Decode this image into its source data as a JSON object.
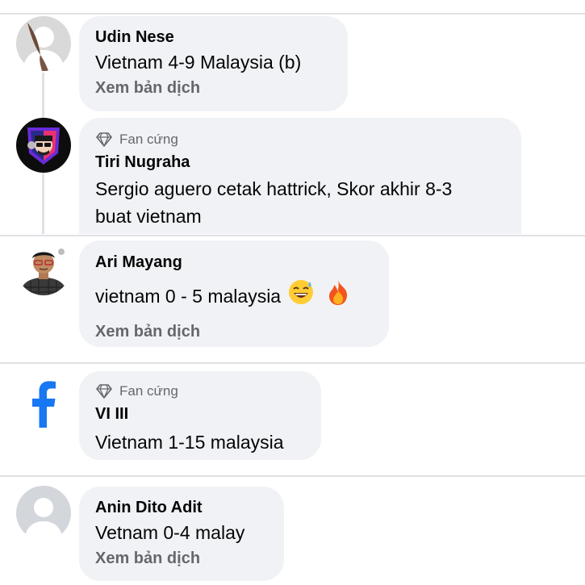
{
  "comments": [
    {
      "name": "Udin Nese",
      "text": "Vietnam 4-9 Malaysia (b)",
      "translate": "Xem bản dịch"
    },
    {
      "badge": "Fan cứng",
      "name": "Tiri Nugraha",
      "text_lines": [
        "Sergio aguero cetak hattrick, Skor akhir 8-3",
        "buat vietnam"
      ]
    },
    {
      "name": "Ari Mayang",
      "text": "vietnam 0 - 5 malaysia",
      "emojis": [
        "😅",
        "🔥"
      ],
      "translate": "Xem bản dịch"
    },
    {
      "badge": "Fan cứng",
      "name": "VI III",
      "text": "Vietnam 1-15 malaysia"
    },
    {
      "name": "Anin Dito Adit",
      "text": "Vetnam 0-4 malay",
      "translate": "Xem bản dịch"
    }
  ],
  "colors": {
    "bubble": "#f0f2f5",
    "divider": "#dfe1e5",
    "secondary_text": "#65676b",
    "facebook_blue": "#1877f2"
  },
  "icons": [
    "diamond-icon",
    "facebook-logo-icon",
    "default-avatar-icon"
  ]
}
